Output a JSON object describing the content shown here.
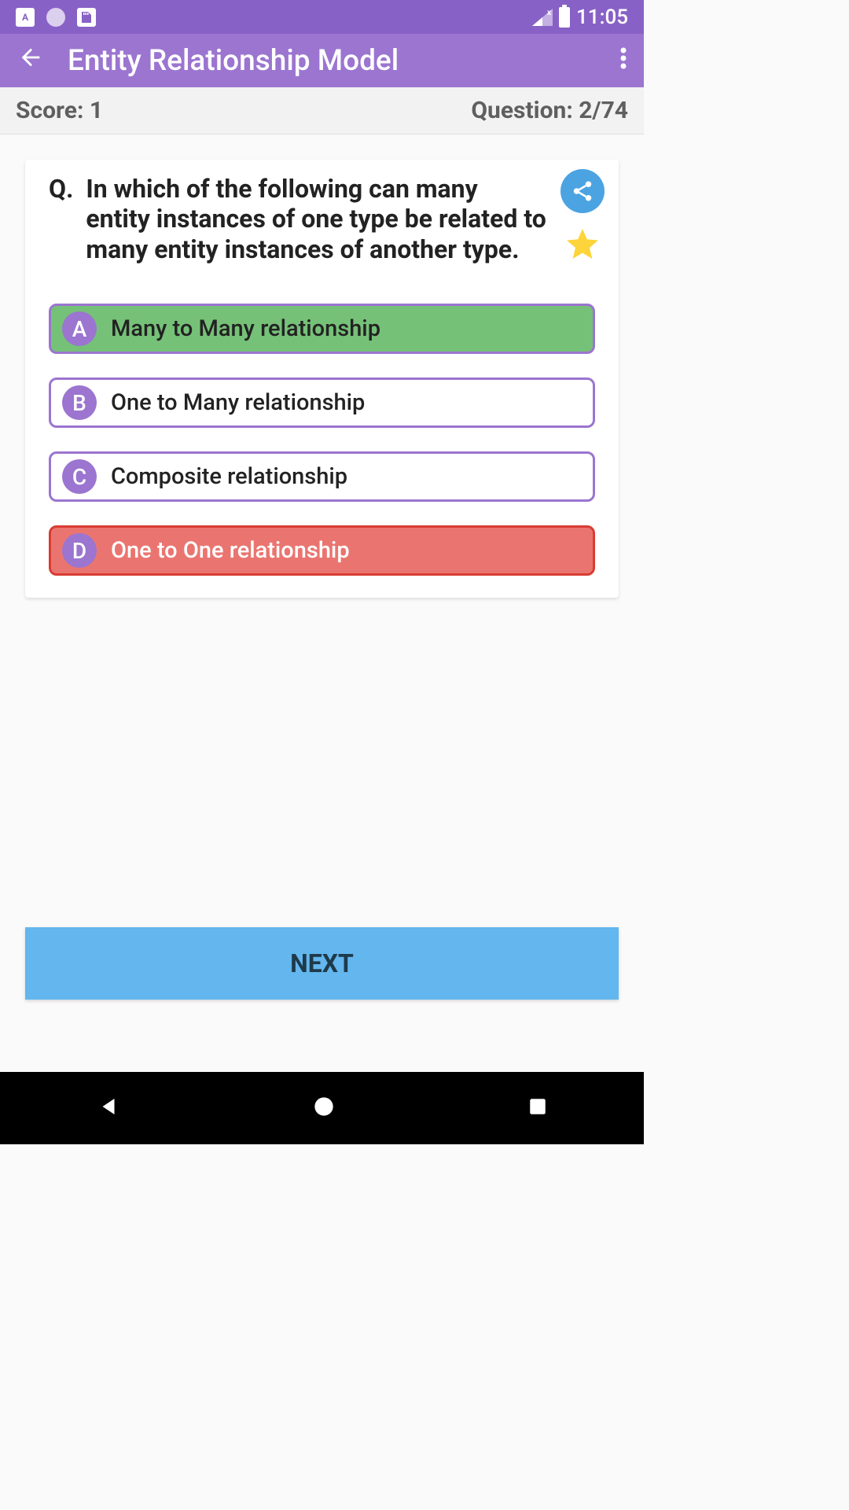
{
  "status": {
    "time": "11:05"
  },
  "appbar": {
    "title": "Entity Relationship Model"
  },
  "info": {
    "score_label": "Score: 1",
    "question_label": "Question: 2/74"
  },
  "question": {
    "prefix": "Q.",
    "text": "In which of the following can many entity instances of one type be related to many entity instances of another type."
  },
  "answers": [
    {
      "letter": "A",
      "text": "Many to Many relationship",
      "state": "correct"
    },
    {
      "letter": "B",
      "text": "One to Many relationship",
      "state": "neutral"
    },
    {
      "letter": "C",
      "text": "Composite relationship",
      "state": "neutral"
    },
    {
      "letter": "D",
      "text": "One to One relationship",
      "state": "wrong"
    }
  ],
  "next_label": "NEXT"
}
